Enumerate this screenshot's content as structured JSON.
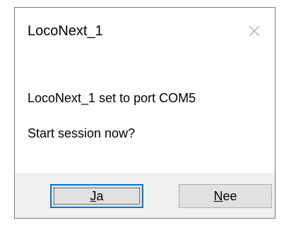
{
  "dialog": {
    "title": "LocoNext_1",
    "close_icon": "close-icon"
  },
  "message": {
    "line1": "LocoNext_1 set to port COM5",
    "line2": "Start session now?"
  },
  "buttons": {
    "ja": {
      "accel": "J",
      "rest": "a"
    },
    "nee": {
      "accel": "N",
      "rest": "ee"
    }
  },
  "colors": {
    "focus_border": "#0078d7",
    "footer_bg": "#f0f0f0",
    "button_bg": "#e1e1e1"
  }
}
